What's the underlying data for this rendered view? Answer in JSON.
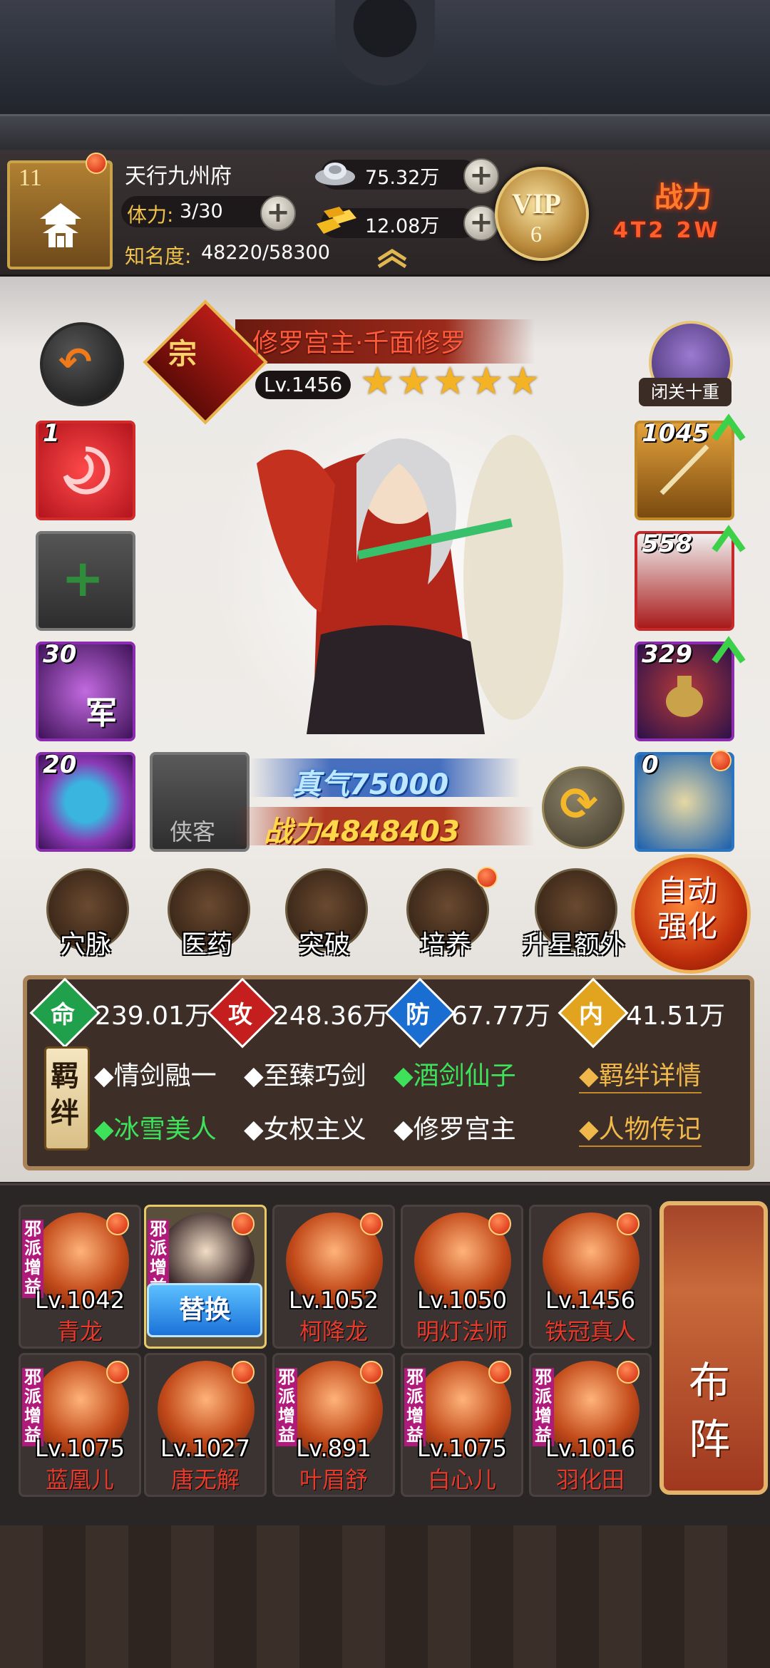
{
  "header": {
    "player_level": "11",
    "place_name": "天行九州府",
    "stamina_label": "体力:",
    "stamina_value": "3/30",
    "fame_label": "知名度:",
    "fame_value": "48220/58300",
    "silver": "75.32万",
    "gold": "12.08万",
    "vip_text": "VIP",
    "vip_level": "6",
    "power_label": "战力",
    "power_value": "4T2 2W"
  },
  "hero": {
    "class_emblem": "宗",
    "name": "修罗宫主·千面修罗",
    "level": "Lv.1456",
    "stars": 5,
    "retreat_label": "闭关十重",
    "energy": "真气75000",
    "power": "战力4848403",
    "companion_slot_label": "侠客",
    "slots": {
      "skill": "1",
      "army": "30",
      "army_char": "军",
      "orb": "20",
      "weapon": "1045",
      "armor": "558",
      "accessory": "329",
      "mount": "0"
    }
  },
  "functions": [
    {
      "label": "穴脉",
      "icon": "acupoint-icon"
    },
    {
      "label": "医药",
      "icon": "medicine-icon"
    },
    {
      "label": "突破",
      "icon": "breakthrough-icon"
    },
    {
      "label": "培养",
      "icon": "cultivate-icon"
    },
    {
      "label": "升星额外",
      "icon": "starup-icon"
    }
  ],
  "auto_enhance": "自动强化",
  "stats": {
    "hp_char": "命",
    "hp": "239.01万",
    "atk_char": "攻",
    "atk": "248.36万",
    "def_char": "防",
    "def": "67.77万",
    "int_char": "内",
    "int": "41.51万"
  },
  "bonds": {
    "tag": "羁绊",
    "items": [
      {
        "label": "◆情剑融一",
        "active": false
      },
      {
        "label": "◆至臻巧剑",
        "active": false
      },
      {
        "label": "◆酒剑仙子",
        "active": true
      },
      {
        "label": "◆冰雪美人",
        "active": true
      },
      {
        "label": "◆女权主义",
        "active": false
      },
      {
        "label": "◆修罗宫主",
        "active": false
      }
    ],
    "details_link": "◆羁绊详情",
    "biography_link": "◆人物传记"
  },
  "roster": [
    {
      "level": "Lv.1042",
      "name": "青龙",
      "evil": "邪派增益"
    },
    {
      "level": "",
      "name": "",
      "evil": "邪派增益",
      "selected": true
    },
    {
      "level": "Lv.1052",
      "name": "柯降龙",
      "evil": ""
    },
    {
      "level": "Lv.1050",
      "name": "明灯法师",
      "evil": ""
    },
    {
      "level": "Lv.1456",
      "name": "铁冠真人",
      "evil": ""
    },
    {
      "level": "Lv.1075",
      "name": "蓝凰儿",
      "evil": "邪派增益"
    },
    {
      "level": "Lv.1027",
      "name": "唐无解",
      "evil": ""
    },
    {
      "level": "Lv.891",
      "name": "叶眉舒",
      "evil": "邪派增益"
    },
    {
      "level": "Lv.1075",
      "name": "白心儿",
      "evil": "邪派增益"
    },
    {
      "level": "Lv.1016",
      "name": "羽化田",
      "evil": "邪派增益"
    }
  ],
  "replace_button": "替换",
  "formation_button": "布阵",
  "colors": {
    "accent_gold": "#e8c96a",
    "bond_active": "#3de25a",
    "name_red": "#e83a2a"
  }
}
